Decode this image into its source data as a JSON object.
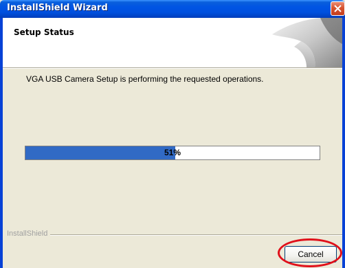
{
  "window": {
    "title": "InstallShield Wizard"
  },
  "header": {
    "title": "Setup Status"
  },
  "status": {
    "message": "VGA USB Camera Setup is performing the requested operations."
  },
  "progress": {
    "value": 0.51,
    "label": "51%"
  },
  "footer": {
    "brand": "InstallShield",
    "cancel_label": "Cancel"
  },
  "annotation": {
    "color": "#e0101a"
  },
  "colors": {
    "accent": "#316ac5",
    "titlebar": "#0054e3",
    "background": "#ece9d8"
  },
  "icons": {
    "close": "close-icon"
  }
}
